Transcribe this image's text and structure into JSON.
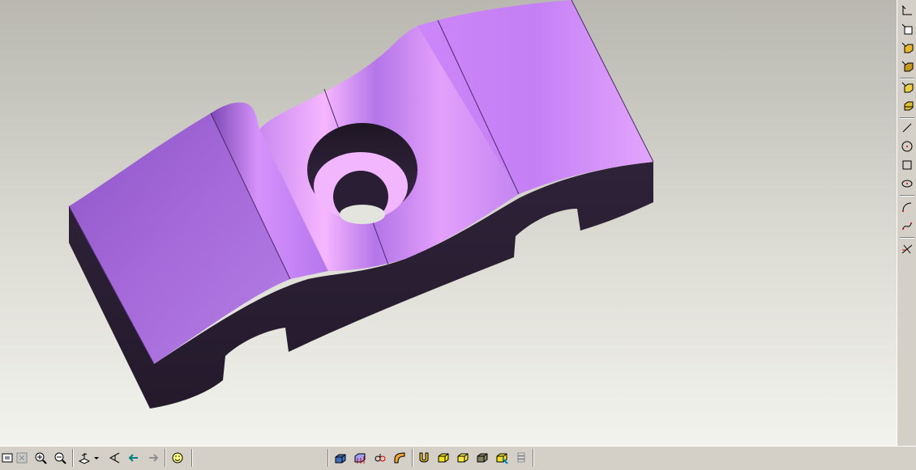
{
  "viewport": {
    "background_top": "#b9b8b0",
    "background_bottom": "#f3f3ee",
    "part_color": "#a86cd8",
    "part_highlight": "#f0a8ff",
    "part_shadow": "#2a2030"
  },
  "right_toolbar": {
    "items": [
      {
        "icon": "datum-axis-icon"
      },
      {
        "icon": "datum-plane-icon"
      },
      {
        "icon": "extrude-cube-icon"
      },
      {
        "icon": "revolve-cube-icon"
      },
      {
        "icon": "shell-cube-icon"
      },
      {
        "icon": "pattern-cube-icon"
      },
      {
        "icon": "line-icon"
      },
      {
        "icon": "circle-icon"
      },
      {
        "icon": "rectangle-icon"
      },
      {
        "icon": "ellipse-icon"
      },
      {
        "icon": "arc-icon"
      },
      {
        "icon": "spline-icon"
      },
      {
        "icon": "trim-icon"
      }
    ]
  },
  "bottom_toolbar": {
    "items": [
      {
        "icon": "refit-icon"
      },
      {
        "icon": "zoom-window-icon"
      },
      {
        "icon": "zoom-in-icon"
      },
      {
        "icon": "zoom-out-icon"
      },
      {
        "icon": "view-orient-icon"
      },
      {
        "icon": "dropdown-arrow-icon"
      },
      {
        "icon": "previous-view-icon"
      },
      {
        "icon": "back-arrow-icon"
      },
      {
        "icon": "forward-arrow-icon"
      },
      {
        "icon": "smiley-icon"
      },
      {
        "icon": "shaded-model-icon"
      },
      {
        "icon": "datum-display-icon"
      },
      {
        "icon": "spin-center-icon"
      },
      {
        "icon": "round-feature-icon"
      },
      {
        "icon": "magnet-icon"
      },
      {
        "icon": "cube-shade-icon"
      },
      {
        "icon": "cube-hidden-icon"
      },
      {
        "icon": "cube-wire-icon"
      },
      {
        "icon": "cube-render-icon"
      },
      {
        "icon": "layer-stack-icon"
      }
    ]
  }
}
